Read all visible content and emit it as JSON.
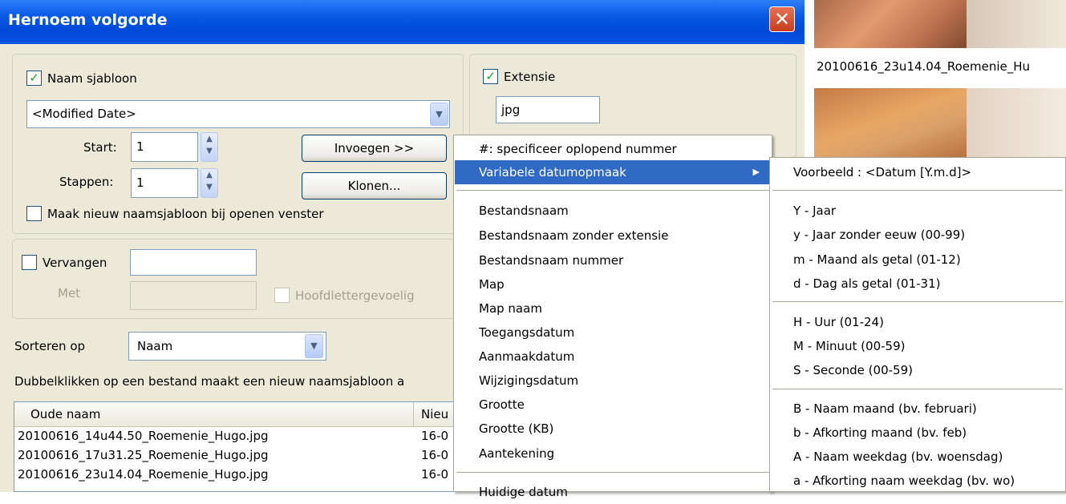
{
  "window": {
    "title": "Hernoem volgorde",
    "close_glyph": "✕"
  },
  "naam_sjabloon": {
    "checkbox_label": "Naam sjabloon",
    "template_value": "<Modified Date>",
    "start_label": "Start:",
    "start_value": "1",
    "steps_label": "Stappen:",
    "steps_value": "1",
    "insert_button": "Invoegen >>",
    "clone_button": "Klonen...",
    "new_on_open_label": "Maak nieuw naamsjabloon bij openen venster"
  },
  "extensie": {
    "checkbox_label": "Extensie",
    "value": "jpg"
  },
  "vervangen": {
    "checkbox_label": "Vervangen",
    "with_label": "Met",
    "case_label": "Hoofdlettergevoelig"
  },
  "sort": {
    "label": "Sorteren op",
    "value": "Naam"
  },
  "hint": "Dubbelklikken op een bestand maakt een nieuw naamsjabloon a",
  "file_table": {
    "columns": [
      "Oude naam",
      "Nieu"
    ],
    "rows": [
      [
        "20100616_14u44.50_Roemenie_Hugo.jpg",
        "16-0"
      ],
      [
        "20100616_17u31.25_Roemenie_Hugo.jpg",
        "16-0"
      ],
      [
        "20100616_23u14.04_Roemenie_Hugo.jpg",
        "16-0"
      ]
    ]
  },
  "context_menu": {
    "items": [
      "#: specificeer oplopend nummer",
      "Variabele datumopmaak",
      "Bestandsnaam",
      "Bestandsnaam zonder extensie",
      "Bestandsnaam nummer",
      "Map",
      "Map naam",
      "Toegangsdatum",
      "Aanmaakdatum",
      "Wijzigingsdatum",
      "Grootte",
      "Grootte (KB)",
      "Aantekening",
      "Huidige datum"
    ],
    "submenu_arrow": "▶"
  },
  "date_submenu": {
    "example": "Voorbeeld : <Datum [Y.m.d]>",
    "items": [
      "Y - Jaar",
      "y - Jaar zonder eeuw (00-99)",
      "m - Maand als getal (01-12)",
      "d - Dag als getal (01-31)",
      "H - Uur (01-24)",
      "M - Minuut (00-59)",
      "S - Seconde (00-59)",
      "B - Naam maand (bv. februari)",
      "b - Afkorting maand (bv. feb)",
      "A - Naam weekdag (bv. woensdag)",
      "a - Afkorting naam weekdag (bv. wo)"
    ]
  },
  "background": {
    "thumb_caption": "20100616_23u14.04_Roemenie_Hu"
  },
  "icons": {
    "check": "✓",
    "dropdown": "▼",
    "spin_up": "▲",
    "spin_down": "▼"
  }
}
